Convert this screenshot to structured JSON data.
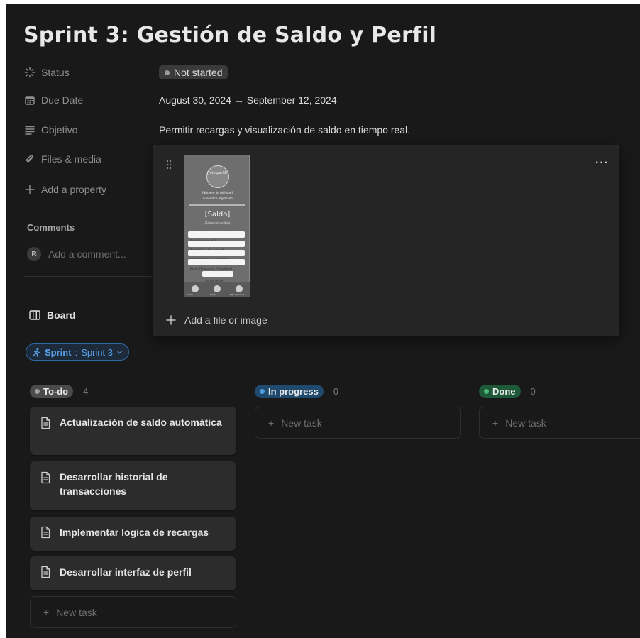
{
  "page": {
    "title": "Sprint 3: Gestión de Saldo y Perfil"
  },
  "properties": {
    "status": {
      "label": "Status",
      "value": "Not started"
    },
    "due_date": {
      "label": "Due Date",
      "value": "August 30, 2024 → September 12, 2024"
    },
    "objective": {
      "label": "Objetivo",
      "value": "Permitir recargas y visualización de saldo en tiempo real."
    },
    "files": {
      "label": "Files & media"
    },
    "add_property": {
      "label": "Add a property"
    }
  },
  "comments": {
    "title": "Comments",
    "avatar_initial": "R",
    "placeholder": "Add a comment..."
  },
  "files_popup": {
    "add_label": "Add a file or image",
    "more_label": "···",
    "thumbnail": {
      "profile_caption": "(foto perfil)",
      "phone_caption": "[Número de teléfono]",
      "user_caption": "(Tu nombre registrado)",
      "balance_caption": "[Saldo]",
      "balance_sub": "(Saldo disponible)",
      "buttons": [
        "Botón [Acerca de]",
        "Botón [P. de Privacidad]",
        "Botón [Centros Autorizados]",
        "Botón [Preguntas Frecuentes]"
      ],
      "logout": "Cerrar sesión",
      "nav": [
        "Inicio",
        "Perfil",
        "Más opciones"
      ]
    }
  },
  "view": {
    "tab_label": "Board"
  },
  "filter": {
    "key": "Sprint",
    "value": "Sprint 3"
  },
  "board": {
    "columns": [
      {
        "name": "To-do",
        "count": "4",
        "pill_color": "#4b4b4b",
        "dot_color": "#a0a0a0"
      },
      {
        "name": "In progress",
        "count": "0",
        "pill_color": "#1f4a6e",
        "dot_color": "#4d9de0"
      },
      {
        "name": "Done",
        "count": "0",
        "pill_color": "#1e5a3a",
        "dot_color": "#4dbb7a"
      }
    ],
    "todo_cards": [
      "Actualización de saldo automática",
      "Desarrollar historial de transacciones",
      "Implementar logica de recargas",
      "Desarrollar interfaz de perfil"
    ],
    "new_task_label": "New task"
  }
}
